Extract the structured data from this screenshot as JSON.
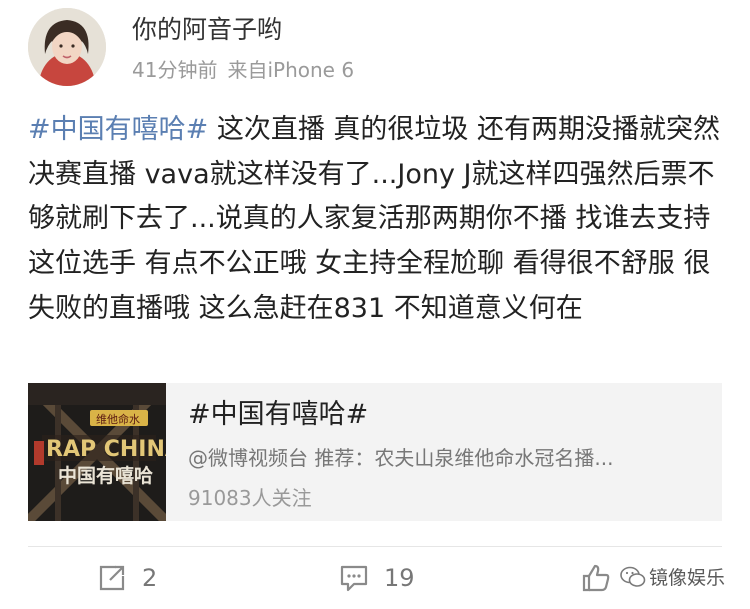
{
  "post": {
    "username": "你的阿音子哟",
    "time": "41分钟前",
    "source": "来自iPhone 6",
    "hashtag": "#中国有嘻哈#",
    "text": " 这次直播 真的很垃圾 还有两期没播就突然决赛直播 vava就这样没有了...Jony J就这样四强然后票不够就刷下去了...说真的人家复活那两期你不播 找谁去支持这位选手 有点不公正哦 女主持全程尬聊 看得很不舒服 很失败的直播哦 这么急赶在831 不知道意义何在"
  },
  "card": {
    "title": "#中国有嘻哈#",
    "subtitle": "@微博视频台 推荐：农夫山泉维他命水冠名播...",
    "followers": "91083人关注",
    "thumb_text": {
      "tag": "维他命水",
      "logo": "RAP CHINA",
      "name": "中国有嘻哈"
    }
  },
  "actions": {
    "repost_count": "2",
    "comment_count": "19",
    "like_count": ""
  },
  "watermark": {
    "text": "镜像娱乐"
  },
  "icons": [
    "repost-icon",
    "comment-icon",
    "like-icon",
    "wechat-icon"
  ],
  "colors": {
    "hashtag": "#5b7fb2",
    "meta": "#9a9a9a",
    "card_bg": "#f3f3f3"
  }
}
